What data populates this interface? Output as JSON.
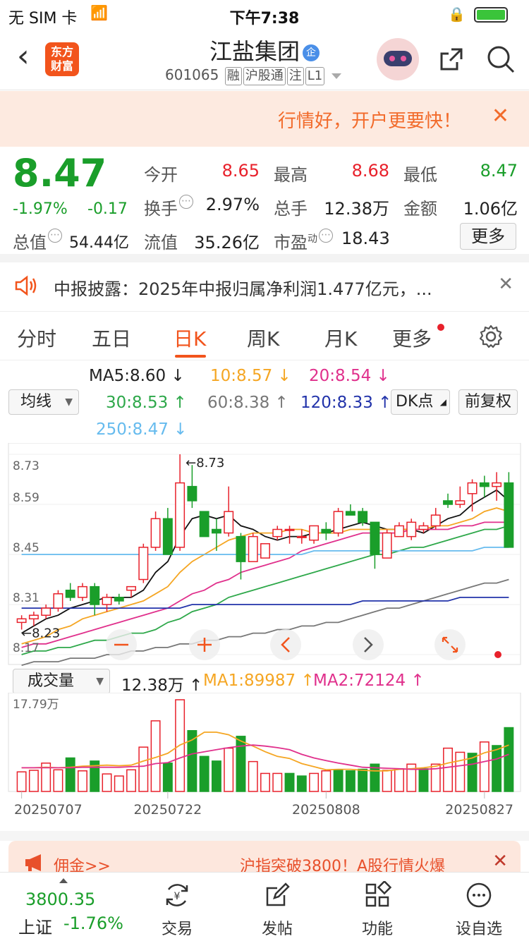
{
  "status_bar": {
    "carrier": "无 SIM 卡",
    "time": "下午7:38"
  },
  "header": {
    "logo_line1": "东方",
    "logo_line2": "财富",
    "stock_name": "江盐集团",
    "badge": "企",
    "code": "601065",
    "tags": [
      "融",
      "沪股通",
      "注",
      "L1"
    ]
  },
  "banner": {
    "text": "行情好，开户更要快！"
  },
  "quote": {
    "price": "8.47",
    "change_pct": "-1.97%",
    "change": "-0.17",
    "total_cap_label": "总值",
    "total_cap": "54.44亿",
    "open_label": "今开",
    "open": "8.65",
    "high_label": "最高",
    "high": "8.68",
    "low_label": "最低",
    "low": "8.47",
    "turnover_label": "换手",
    "turnover": "2.97%",
    "volume_label": "总手",
    "volume": "12.38万",
    "amount_label": "金额",
    "amount": "1.06亿",
    "float_cap_label": "流值",
    "float_cap": "35.26亿",
    "pe_label": "市盈",
    "pe_sup": "动",
    "pe": "18.43",
    "more_label": "更多"
  },
  "notice": {
    "text": "中报披露：2025年中报归属净利润1.477亿元，..."
  },
  "tabs": {
    "items": [
      "分时",
      "五日",
      "日K",
      "周K",
      "月K",
      "更多"
    ],
    "active": "日K"
  },
  "ma_row": {
    "selector": "均线",
    "ma5": "MA5:8.60 ↓",
    "ma10": "10:8.57 ↓",
    "ma20": "20:8.54 ↓",
    "ma30": "30:8.53 ↑",
    "ma60": "60:8.38 ↑",
    "ma120": "120:8.33 ↑",
    "ma250": "250:8.47 ↓",
    "dk_button": "DK点",
    "fq_button": "前复权"
  },
  "colors": {
    "up": "#e8212b",
    "down": "#1a9e2a",
    "ma5": "#111111",
    "ma10": "#f5a623",
    "ma20": "#e0308c",
    "ma30": "#2ea84a",
    "ma60": "#777777",
    "ma120": "#2233aa",
    "ma250": "#66bbee",
    "accent": "#f2541c"
  },
  "chart_data": [
    {
      "type": "candlestick",
      "y_ticks": [
        "8.73",
        "8.59",
        "8.45",
        "8.31",
        "8.17"
      ],
      "ylim": [
        8.17,
        8.73
      ],
      "high_marker": "←8.73",
      "low_marker": "←8.23",
      "candles": [
        {
          "o": 8.26,
          "h": 8.28,
          "l": 8.24,
          "c": 8.27
        },
        {
          "o": 8.27,
          "h": 8.29,
          "l": 8.25,
          "c": 8.28
        },
        {
          "o": 8.28,
          "h": 8.31,
          "l": 8.27,
          "c": 8.3
        },
        {
          "o": 8.3,
          "h": 8.35,
          "l": 8.29,
          "c": 8.34
        },
        {
          "o": 8.35,
          "h": 8.37,
          "l": 8.32,
          "c": 8.33
        },
        {
          "o": 8.33,
          "h": 8.37,
          "l": 8.32,
          "c": 8.36
        },
        {
          "o": 8.36,
          "h": 8.37,
          "l": 8.28,
          "c": 8.31
        },
        {
          "o": 8.31,
          "h": 8.34,
          "l": 8.29,
          "c": 8.33
        },
        {
          "o": 8.33,
          "h": 8.34,
          "l": 8.31,
          "c": 8.32
        },
        {
          "o": 8.35,
          "h": 8.36,
          "l": 8.33,
          "c": 8.36
        },
        {
          "o": 8.38,
          "h": 8.48,
          "l": 8.37,
          "c": 8.47
        },
        {
          "o": 8.47,
          "h": 8.57,
          "l": 8.46,
          "c": 8.55
        },
        {
          "o": 8.55,
          "h": 8.58,
          "l": 8.46,
          "c": 8.45
        },
        {
          "o": 8.47,
          "h": 8.73,
          "l": 8.46,
          "c": 8.65
        },
        {
          "o": 8.64,
          "h": 8.7,
          "l": 8.58,
          "c": 8.6
        },
        {
          "o": 8.57,
          "h": 8.57,
          "l": 8.5,
          "c": 8.5
        },
        {
          "o": 8.52,
          "h": 8.55,
          "l": 8.46,
          "c": 8.51
        },
        {
          "o": 8.51,
          "h": 8.64,
          "l": 8.5,
          "c": 8.57
        },
        {
          "o": 8.5,
          "h": 8.51,
          "l": 8.38,
          "c": 8.43
        },
        {
          "o": 8.43,
          "h": 8.51,
          "l": 8.43,
          "c": 8.5
        },
        {
          "o": 8.44,
          "h": 8.48,
          "l": 8.44,
          "c": 8.48
        },
        {
          "o": 8.5,
          "h": 8.53,
          "l": 8.49,
          "c": 8.52
        },
        {
          "o": 8.52,
          "h": 8.53,
          "l": 8.48,
          "c": 8.52
        },
        {
          "o": 8.5,
          "h": 8.52,
          "l": 8.48,
          "c": 8.5
        },
        {
          "o": 8.49,
          "h": 8.53,
          "l": 8.48,
          "c": 8.53
        },
        {
          "o": 8.52,
          "h": 8.54,
          "l": 8.49,
          "c": 8.51
        },
        {
          "o": 8.51,
          "h": 8.58,
          "l": 8.5,
          "c": 8.57
        },
        {
          "o": 8.57,
          "h": 8.59,
          "l": 8.56,
          "c": 8.56
        },
        {
          "o": 8.57,
          "h": 8.58,
          "l": 8.53,
          "c": 8.54
        },
        {
          "o": 8.54,
          "h": 8.54,
          "l": 8.41,
          "c": 8.45
        },
        {
          "o": 8.44,
          "h": 8.52,
          "l": 8.44,
          "c": 8.51
        },
        {
          "o": 8.5,
          "h": 8.54,
          "l": 8.5,
          "c": 8.53
        },
        {
          "o": 8.5,
          "h": 8.55,
          "l": 8.49,
          "c": 8.54
        },
        {
          "o": 8.52,
          "h": 8.54,
          "l": 8.51,
          "c": 8.53
        },
        {
          "o": 8.53,
          "h": 8.58,
          "l": 8.52,
          "c": 8.56
        },
        {
          "o": 8.6,
          "h": 8.62,
          "l": 8.58,
          "c": 8.59
        },
        {
          "o": 8.59,
          "h": 8.64,
          "l": 8.58,
          "c": 8.6
        },
        {
          "o": 8.62,
          "h": 8.66,
          "l": 8.57,
          "c": 8.65
        },
        {
          "o": 8.65,
          "h": 8.67,
          "l": 8.61,
          "c": 8.64
        },
        {
          "o": 8.64,
          "h": 8.68,
          "l": 8.6,
          "c": 8.65
        },
        {
          "o": 8.65,
          "h": 8.68,
          "l": 8.47,
          "c": 8.47
        }
      ],
      "ma_series": [
        {
          "name": "MA5",
          "color": "#111111",
          "values": [
            8.23,
            8.25,
            8.27,
            8.28,
            8.3,
            8.31,
            8.32,
            8.33,
            8.33,
            8.33,
            8.35,
            8.4,
            8.43,
            8.5,
            8.55,
            8.56,
            8.55,
            8.56,
            8.53,
            8.52,
            8.5,
            8.49,
            8.5,
            8.5,
            8.51,
            8.51,
            8.52,
            8.53,
            8.54,
            8.53,
            8.52,
            8.52,
            8.52,
            8.51,
            8.53,
            8.55,
            8.56,
            8.59,
            8.61,
            8.63,
            8.6
          ]
        },
        {
          "name": "MA10",
          "color": "#f5a623",
          "values": [
            8.2,
            8.21,
            8.22,
            8.24,
            8.25,
            8.27,
            8.28,
            8.29,
            8.3,
            8.31,
            8.32,
            8.34,
            8.36,
            8.4,
            8.43,
            8.45,
            8.47,
            8.49,
            8.5,
            8.51,
            8.51,
            8.51,
            8.52,
            8.52,
            8.51,
            8.51,
            8.51,
            8.52,
            8.52,
            8.52,
            8.52,
            8.52,
            8.52,
            8.52,
            8.53,
            8.53,
            8.54,
            8.55,
            8.57,
            8.58,
            8.57
          ]
        },
        {
          "name": "MA20",
          "color": "#e0308c",
          "values": [
            8.19,
            8.2,
            8.2,
            8.21,
            8.22,
            8.23,
            8.24,
            8.25,
            8.26,
            8.27,
            8.28,
            8.29,
            8.3,
            8.32,
            8.34,
            8.35,
            8.37,
            8.38,
            8.4,
            8.41,
            8.42,
            8.43,
            8.44,
            8.46,
            8.47,
            8.48,
            8.49,
            8.5,
            8.51,
            8.51,
            8.51,
            8.51,
            8.52,
            8.52,
            8.52,
            8.52,
            8.53,
            8.53,
            8.54,
            8.54,
            8.54
          ]
        },
        {
          "name": "MA30",
          "color": "#2ea84a",
          "values": [
            8.17,
            8.18,
            8.18,
            8.19,
            8.19,
            8.2,
            8.21,
            8.21,
            8.22,
            8.23,
            8.23,
            8.24,
            8.26,
            8.27,
            8.29,
            8.3,
            8.31,
            8.33,
            8.34,
            8.35,
            8.36,
            8.37,
            8.38,
            8.39,
            8.4,
            8.41,
            8.42,
            8.43,
            8.44,
            8.45,
            8.45,
            8.46,
            8.47,
            8.47,
            8.48,
            8.49,
            8.5,
            8.51,
            8.52,
            8.52,
            8.53
          ]
        },
        {
          "name": "MA60",
          "color": "#777777",
          "values": [
            8.14,
            8.15,
            8.15,
            8.15,
            8.16,
            8.16,
            8.16,
            8.17,
            8.17,
            8.18,
            8.18,
            8.19,
            8.19,
            8.2,
            8.2,
            8.21,
            8.21,
            8.22,
            8.22,
            8.23,
            8.23,
            8.24,
            8.24,
            8.25,
            8.25,
            8.26,
            8.26,
            8.27,
            8.28,
            8.29,
            8.3,
            8.3,
            8.31,
            8.32,
            8.33,
            8.34,
            8.35,
            8.36,
            8.37,
            8.37,
            8.38
          ]
        },
        {
          "name": "MA120",
          "color": "#2233aa",
          "values": [
            8.3,
            8.3,
            8.3,
            8.3,
            8.3,
            8.3,
            8.3,
            8.3,
            8.3,
            8.3,
            8.3,
            8.3,
            8.3,
            8.3,
            8.31,
            8.31,
            8.31,
            8.31,
            8.31,
            8.31,
            8.31,
            8.31,
            8.31,
            8.31,
            8.31,
            8.31,
            8.31,
            8.31,
            8.32,
            8.32,
            8.32,
            8.32,
            8.32,
            8.32,
            8.32,
            8.32,
            8.33,
            8.33,
            8.33,
            8.33,
            8.33
          ]
        },
        {
          "name": "MA250",
          "color": "#66bbee",
          "values": [
            8.45,
            8.45,
            8.45,
            8.45,
            8.45,
            8.45,
            8.45,
            8.45,
            8.45,
            8.45,
            8.45,
            8.45,
            8.45,
            8.45,
            8.45,
            8.45,
            8.45,
            8.45,
            8.45,
            8.45,
            8.45,
            8.45,
            8.45,
            8.45,
            8.46,
            8.46,
            8.46,
            8.46,
            8.46,
            8.46,
            8.46,
            8.46,
            8.46,
            8.46,
            8.46,
            8.46,
            8.46,
            8.46,
            8.47,
            8.47,
            8.47
          ]
        }
      ]
    },
    {
      "type": "bar",
      "selector": "成交量",
      "volume_label": "12.38万 ↑",
      "ma1_label": "MA1:89987 ↑",
      "ma2_label": "MA2:72124 ↑",
      "y_top_label": "17.79万",
      "ylim": [
        0,
        17.79
      ],
      "x_labels": [
        "20250707",
        "20250722",
        "20250808",
        "20250827"
      ],
      "bars": [
        {
          "v": 3.8,
          "up": true
        },
        {
          "v": 4.1,
          "up": true
        },
        {
          "v": 5.5,
          "up": true
        },
        {
          "v": 4.2,
          "up": true
        },
        {
          "v": 6.5,
          "up": false
        },
        {
          "v": 4.0,
          "up": true
        },
        {
          "v": 5.9,
          "up": false
        },
        {
          "v": 3.4,
          "up": true
        },
        {
          "v": 3.0,
          "up": true
        },
        {
          "v": 4.2,
          "up": true
        },
        {
          "v": 8.6,
          "up": true
        },
        {
          "v": 13.7,
          "up": true
        },
        {
          "v": 5.5,
          "up": false
        },
        {
          "v": 17.79,
          "up": true
        },
        {
          "v": 11.8,
          "up": false
        },
        {
          "v": 6.8,
          "up": false
        },
        {
          "v": 5.9,
          "up": false
        },
        {
          "v": 8.4,
          "up": true
        },
        {
          "v": 10.7,
          "up": false
        },
        {
          "v": 5.8,
          "up": true
        },
        {
          "v": 3.5,
          "up": true
        },
        {
          "v": 3.5,
          "up": true
        },
        {
          "v": 3.5,
          "up": false
        },
        {
          "v": 3.0,
          "up": false
        },
        {
          "v": 3.5,
          "up": true
        },
        {
          "v": 4.0,
          "up": true
        },
        {
          "v": 4.1,
          "up": false
        },
        {
          "v": 4.0,
          "up": false
        },
        {
          "v": 4.3,
          "up": false
        },
        {
          "v": 5.3,
          "up": false
        },
        {
          "v": 4.1,
          "up": true
        },
        {
          "v": 4.4,
          "up": true
        },
        {
          "v": 5.3,
          "up": true
        },
        {
          "v": 4.4,
          "up": false
        },
        {
          "v": 5.3,
          "up": true
        },
        {
          "v": 8.4,
          "up": true
        },
        {
          "v": 7.6,
          "up": true
        },
        {
          "v": 7.4,
          "up": false
        },
        {
          "v": 9.6,
          "up": true
        },
        {
          "v": 8.9,
          "up": false
        },
        {
          "v": 12.38,
          "up": false
        }
      ],
      "ma1": [
        4.6,
        4.6,
        4.7,
        4.6,
        4.7,
        4.9,
        5.0,
        5.1,
        5.0,
        5.1,
        5.9,
        6.6,
        7.4,
        9.0,
        10.0,
        11.5,
        11.5,
        11.0,
        9.8,
        8.8,
        7.7,
        6.8,
        6.4,
        5.4,
        4.8,
        4.2,
        4.3,
        4.3,
        4.1,
        4.0,
        4.0,
        4.3,
        4.4,
        4.6,
        4.9,
        5.5,
        6.0,
        6.5,
        7.5,
        8.1,
        9.0
      ],
      "ma2": [
        4.6,
        4.6,
        4.6,
        4.6,
        4.6,
        4.7,
        4.7,
        4.7,
        4.7,
        4.8,
        4.9,
        5.4,
        5.6,
        6.5,
        7.3,
        7.7,
        8.1,
        8.5,
        8.8,
        9.0,
        8.8,
        8.5,
        8.1,
        7.2,
        6.5,
        6.0,
        5.5,
        5.1,
        4.7,
        4.6,
        4.5,
        4.4,
        4.3,
        4.3,
        4.4,
        4.7,
        5.0,
        5.3,
        5.8,
        6.3,
        7.2
      ]
    }
  ],
  "bottom_ad": {
    "left_text": "佣金>>",
    "right_text": "沪指突破3800！A股行情火爆"
  },
  "bottom_nav": {
    "index_value": "3800.35",
    "index_name": "上证",
    "index_pct": "-1.76%",
    "items": [
      "交易",
      "发帖",
      "功能",
      "设自选"
    ]
  }
}
